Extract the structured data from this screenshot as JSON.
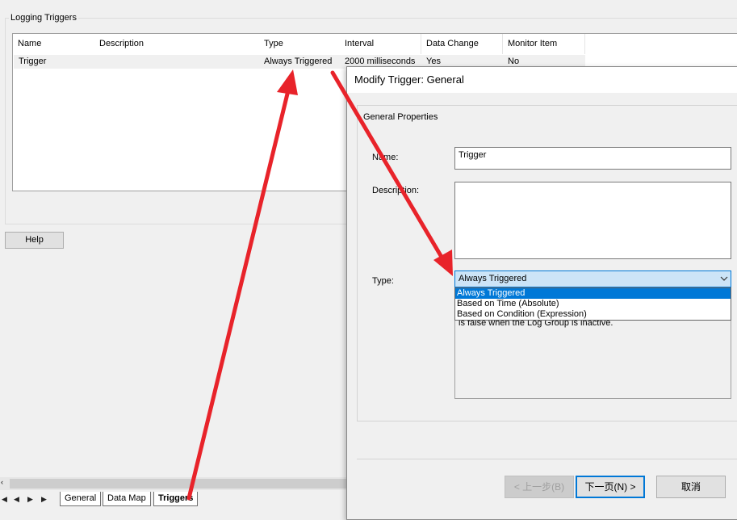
{
  "group": {
    "title": "Logging Triggers"
  },
  "table": {
    "columns": [
      "Name",
      "Description",
      "Type",
      "Interval",
      "Data Change",
      "Monitor Item"
    ],
    "rows": [
      {
        "name": "Trigger",
        "description": "",
        "type": "Always Triggered",
        "interval": "2000 milliseconds",
        "data_change": "Yes",
        "monitor_item": "No"
      }
    ]
  },
  "help_button": "Help",
  "sheet_tabs": {
    "nav": [
      "◀",
      "◀",
      "▶",
      "▶"
    ],
    "tabs": [
      "General",
      "Data Map",
      "Triggers"
    ],
    "active": "Triggers"
  },
  "dialog": {
    "title": "Modify Trigger: General",
    "panel_title": "General Properties",
    "name_label": "Name:",
    "name_value": "Trigger",
    "description_label": "Description:",
    "description_value": "",
    "type_label": "Type:",
    "type_value": "Always Triggered",
    "type_options": [
      "Always Triggered",
      "Based on Time (Absolute)",
      "Based on Condition (Expression)"
    ],
    "type_description": "is false when the Log Group is inactive.",
    "buttons": {
      "back": "< 上一步(B)",
      "next": "下一页(N) >",
      "cancel": "取消"
    }
  },
  "colors": {
    "annotation_arrow": "#e8232a",
    "selection": "#0078d7",
    "combo_bg": "#cce4f7"
  },
  "icons": {
    "combo_arrow": "chevron-down-icon"
  }
}
